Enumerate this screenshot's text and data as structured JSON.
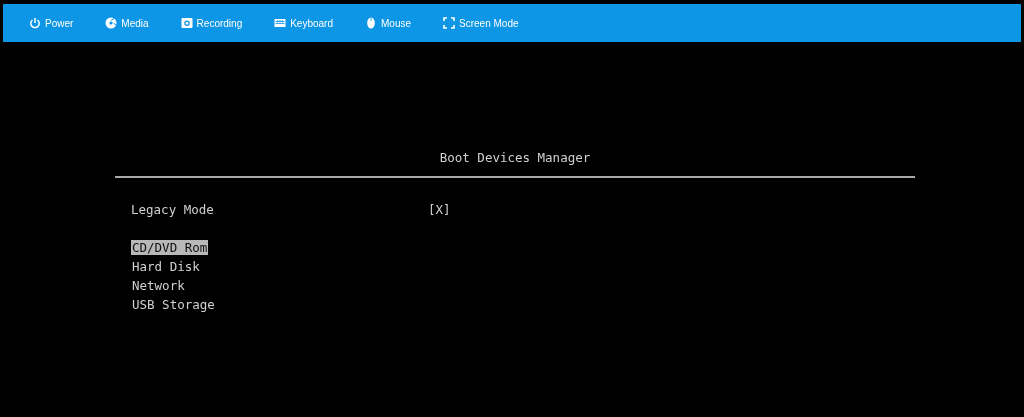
{
  "toolbar": [
    {
      "label": "Power",
      "kind": "power"
    },
    {
      "label": "Media",
      "kind": "disc"
    },
    {
      "label": "Recording",
      "kind": "camera"
    },
    {
      "label": "Keyboard",
      "kind": "keyboard"
    },
    {
      "label": "Mouse",
      "kind": "mouse"
    },
    {
      "label": "Screen Mode",
      "kind": "fullscreen"
    }
  ],
  "screen": {
    "title": "Boot Devices Manager",
    "settings": [
      {
        "label": "Legacy Mode",
        "value": "[X]"
      }
    ],
    "boot_devices": [
      {
        "label": "CD/DVD Rom",
        "selected": true
      },
      {
        "label": "Hard Disk",
        "selected": false
      },
      {
        "label": "Network",
        "selected": false
      },
      {
        "label": "USB Storage",
        "selected": false
      }
    ]
  }
}
